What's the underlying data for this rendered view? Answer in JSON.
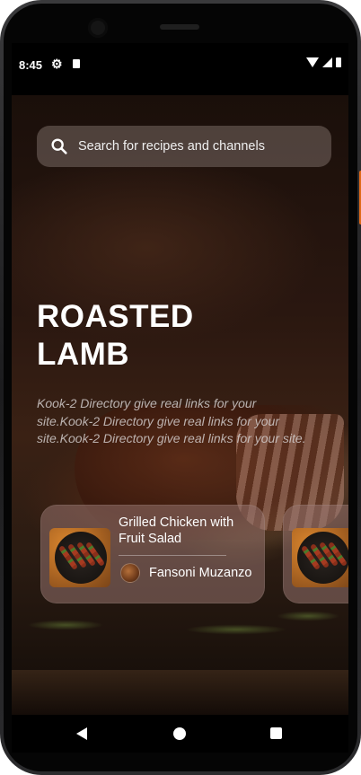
{
  "status_bar": {
    "time": "8:45",
    "icons": [
      "gear-icon",
      "sim-card-icon",
      "wifi-icon",
      "signal-icon",
      "battery-icon"
    ]
  },
  "search": {
    "placeholder": "Search for recipes and channels",
    "icon": "search-icon"
  },
  "hero": {
    "title": "ROASTED LAMB",
    "description": "Kook-2 Directory give real links for your site.Kook-2 Directory give real links for your site.Kook-2 Directory give real links for your site."
  },
  "cards": [
    {
      "title": "Grilled Chicken with Fruit Salad",
      "author": "Fansoni Muzanzo"
    }
  ],
  "nav_bar": {
    "icons": [
      "back-icon",
      "home-icon",
      "recents-icon"
    ]
  },
  "colors": {
    "text": "#ffffff",
    "card_background": "#96736e",
    "search_background": "#78696a"
  }
}
